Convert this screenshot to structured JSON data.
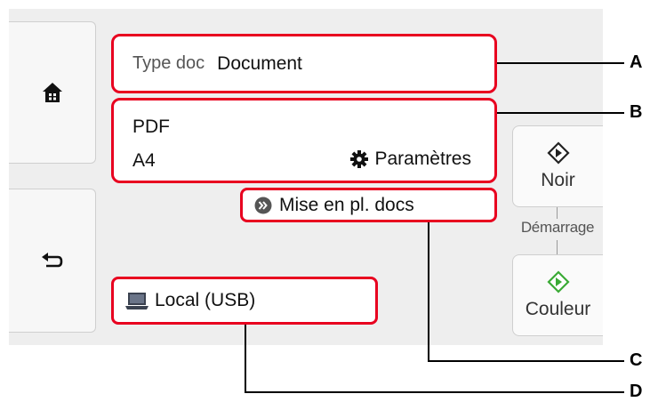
{
  "doc_type": {
    "label": "Type doc",
    "value": "Document"
  },
  "scan_settings": {
    "format": "PDF",
    "size": "A4",
    "settings_label": "Paramètres"
  },
  "placement": {
    "label": "Mise en pl. docs"
  },
  "save_location": {
    "label": "Local (USB)"
  },
  "start": {
    "label": "Démarrage",
    "black_label": "Noir",
    "color_label": "Couleur"
  },
  "callouts": [
    "A",
    "B",
    "C",
    "D"
  ],
  "colors": {
    "highlight": "#e8001f",
    "color_start_icon": "#3aaa35",
    "panel_bg": "#eeeeee"
  },
  "icons": {
    "home": "home-icon",
    "back": "back-arrow-icon",
    "gear": "gear-icon",
    "chevron": "double-chevron-icon",
    "computer": "computer-icon",
    "start": "start-diamond-icon"
  }
}
